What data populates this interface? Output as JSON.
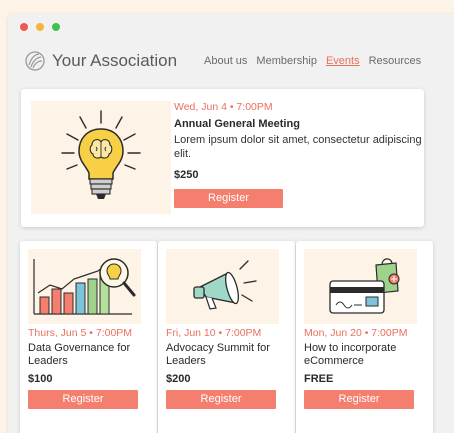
{
  "site": {
    "logo_text": "Your Association"
  },
  "nav": [
    {
      "label": "About us",
      "active": false
    },
    {
      "label": "Membership",
      "active": false
    },
    {
      "label": "Events",
      "active": true
    },
    {
      "label": "Resources",
      "active": false
    }
  ],
  "featured": {
    "date": "Wed, Jun 4 • 7:00PM",
    "title": "Annual General Meeting",
    "desc": "Lorem ipsum dolor sit amet, consectetur adipiscing elit.",
    "price": "$250",
    "button": "Register",
    "icon": "lightbulb-brain-icon"
  },
  "events": [
    {
      "date": "Thurs, Jun 5 • 7:00PM",
      "title": "Data Governance for Leaders",
      "price": "$100",
      "button": "Register",
      "icon": "bar-chart-magnifier-icon"
    },
    {
      "date": "Fri, Jun 10  •  7:00PM",
      "title": "Advocacy Summit for Leaders",
      "price": "$200",
      "button": "Register",
      "icon": "megaphone-icon"
    },
    {
      "date": "Mon, Jun 20 • 7:00PM",
      "title": "How to incorporate eCommerce",
      "price": "FREE",
      "button": "Register",
      "icon": "credit-card-shopping-icon"
    }
  ],
  "colors": {
    "accent": "#ea6f5f",
    "button": "#f47f6f",
    "background": "#fdf3e6",
    "image_bg": "#fdf3e6"
  }
}
